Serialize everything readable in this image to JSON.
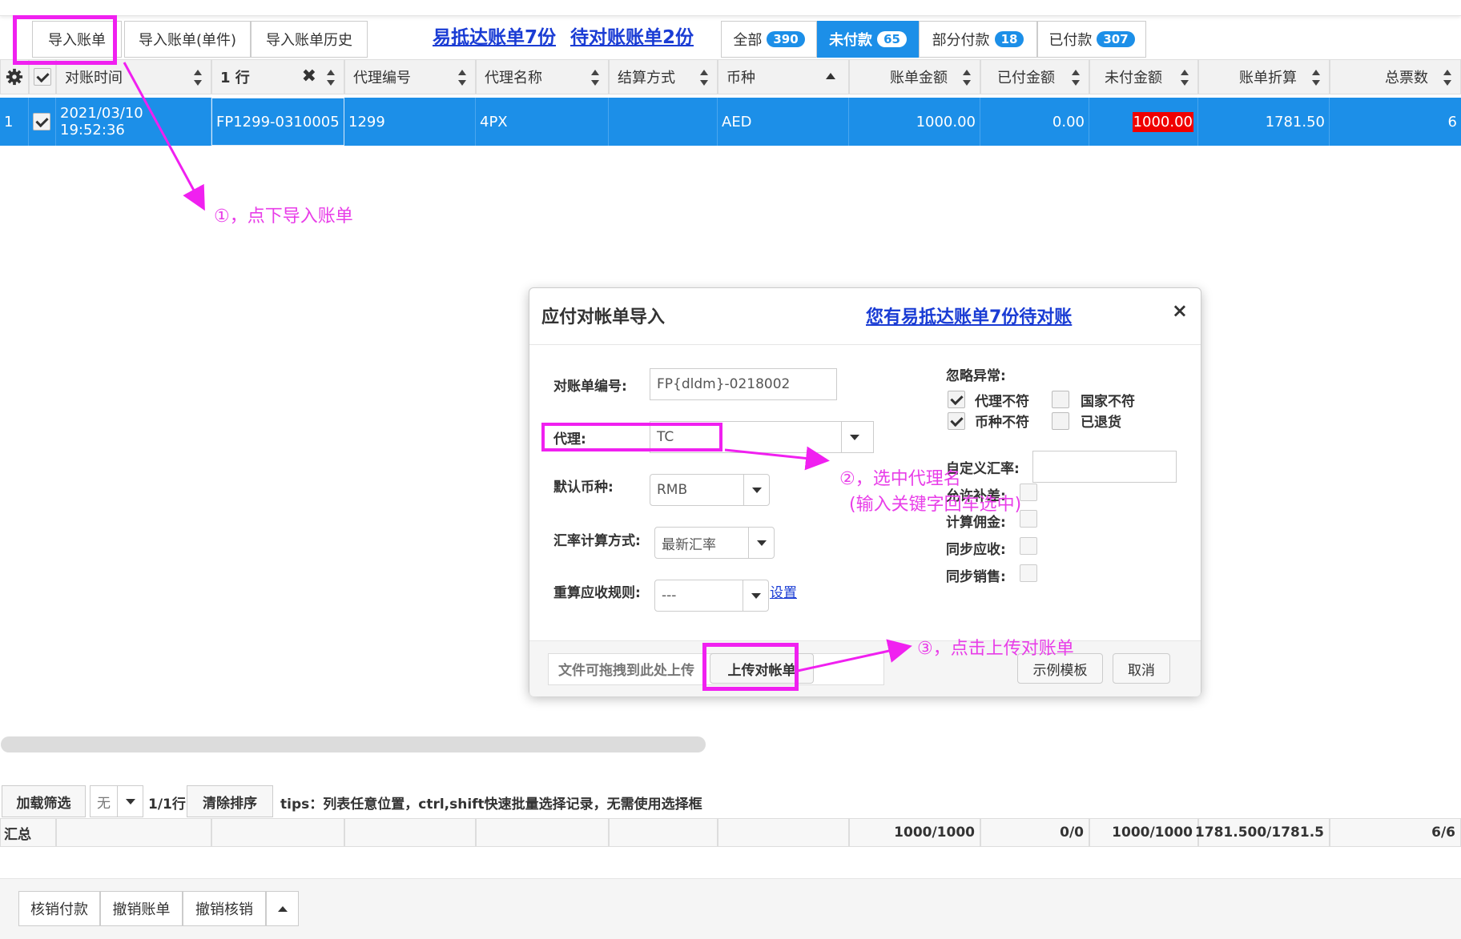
{
  "toolbar": {
    "import_bill": "导入账单",
    "import_single": "导入账单(单件)",
    "import_history": "导入账单历史",
    "link_easy": "易抵达账单7份",
    "link_pending": "待对账账单2份"
  },
  "filter_tabs": [
    {
      "label": "全部",
      "count": "390"
    },
    {
      "label": "未付款",
      "count": "65"
    },
    {
      "label": "部分付款",
      "count": "18"
    },
    {
      "label": "已付款",
      "count": "307"
    }
  ],
  "columns": {
    "time": "对账时间",
    "rows": "1 行",
    "agent_code": "代理编号",
    "agent_name": "代理名称",
    "settle": "结算方式",
    "currency": "币种",
    "bill_amount": "账单金额",
    "paid": "已付金额",
    "unpaid": "未付金额",
    "converted": "账单折算",
    "tickets": "总票数"
  },
  "row": {
    "index": "1",
    "time": "2021/03/10 19:52:36",
    "bill_no": "FP1299-0310005",
    "agent_code": "1299",
    "agent_name": "4PX",
    "settle": "",
    "currency": "AED",
    "bill_amount": "1000.00",
    "paid": "0.00",
    "unpaid": "1000.00",
    "converted": "1781.50",
    "tickets": "6"
  },
  "annotations": {
    "step1": "①，点下导入账单",
    "step2a": "②，选中代理名",
    "step2b": "(输入关键字回车选中)",
    "step3": "③，点击上传对账单"
  },
  "dialog": {
    "title": "应付对帐单导入",
    "link": "您有易抵达账单7份待对账",
    "close": "×",
    "bill_no_label": "对账单编号:",
    "bill_no_value": "FP{dldm}-0218002",
    "agent_label": "代理:",
    "agent_value": "TC",
    "currency_label": "默认币种:",
    "currency_value": "RMB",
    "rate_method_label": "汇率计算方式:",
    "rate_method_value": "最新汇率",
    "recalc_label": "重算应收规则:",
    "recalc_value": "---",
    "settings_link": "设置",
    "ignore_label": "忽略异常:",
    "ignore_agent": "代理不符",
    "ignore_country": "国家不符",
    "ignore_currency": "币种不符",
    "ignore_returned": "已退货",
    "custom_rate_label": "自定义汇率:",
    "allow_diff_label": "允许补差:",
    "calc_commission_label": "计算佣金:",
    "sync_receivable_label": "同步应收:",
    "sync_sales_label": "同步销售:",
    "drop_hint": "文件可拖拽到此处上传",
    "upload_btn": "上传对帐单",
    "template_btn": "示例模板",
    "cancel_btn": "取消"
  },
  "bottom": {
    "load_filter": "加载筛选",
    "filter_value": "无",
    "row_count": "1/1行",
    "clear_sort": "清除排序",
    "tips": "tips：列表任意位置，ctrl,shift快速批量选择记录，无需使用选择框",
    "summary_label": "汇总",
    "sum_bill": "1000/1000",
    "sum_paid": "0/0",
    "sum_unpaid": "1000/1000",
    "sum_converted": "1781.500/1781.5",
    "sum_tickets": "6/6",
    "writeoff_pay": "核销付款",
    "cancel_bill": "撤销账单",
    "cancel_writeoff": "撤销核销"
  }
}
